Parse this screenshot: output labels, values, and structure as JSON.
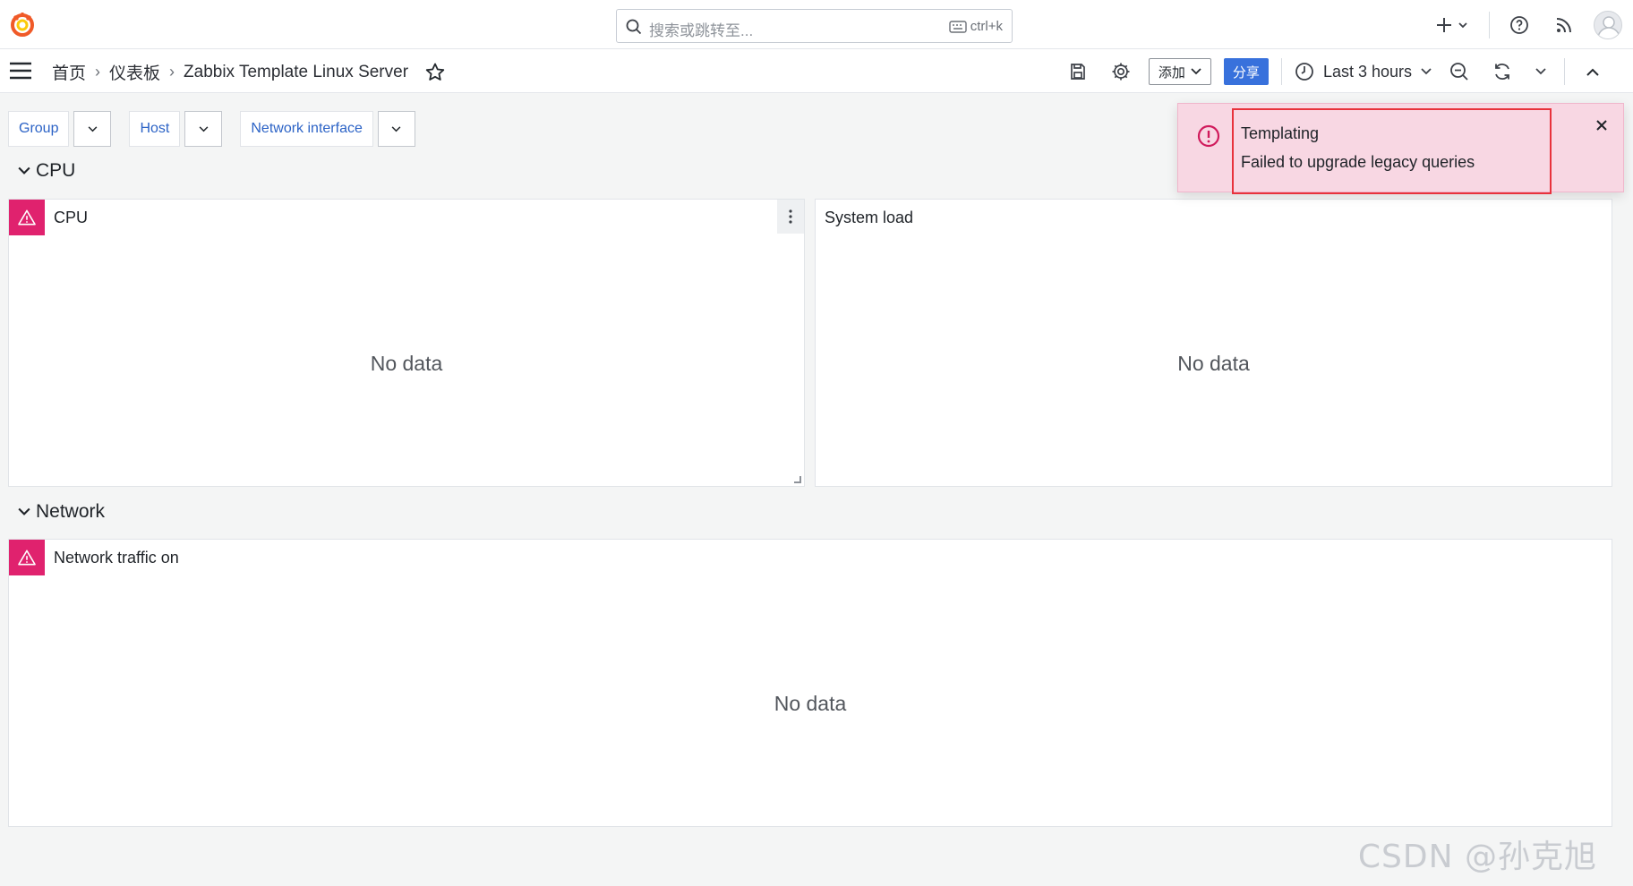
{
  "search": {
    "placeholder": "搜索或跳转至...",
    "shortcut": "ctrl+k"
  },
  "breadcrumb": {
    "home": "首页",
    "dashboards": "仪表板",
    "current": "Zabbix Template Linux Server"
  },
  "toolbar": {
    "add_label": "添加",
    "share_label": "分享",
    "time_range": "Last 3 hours"
  },
  "variables": [
    {
      "label": "Group"
    },
    {
      "label": "Host"
    },
    {
      "label": "Network interface"
    }
  ],
  "rows": [
    {
      "title": "CPU"
    },
    {
      "title": "Network"
    }
  ],
  "panels": {
    "cpu": {
      "title": "CPU",
      "message": "No data"
    },
    "system_load": {
      "title": "System load",
      "message": "No data"
    },
    "network_traffic": {
      "title": "Network traffic on",
      "message": "No data"
    }
  },
  "toast": {
    "title": "Templating",
    "message": "Failed to upgrade legacy queries"
  },
  "watermark": "CSDN @孙克旭",
  "colors": {
    "error": "#e0226e",
    "primary": "#3871dc",
    "link": "#2c63c6",
    "toast_bg": "#f8d7e3",
    "highlight_border": "#e8323c"
  }
}
